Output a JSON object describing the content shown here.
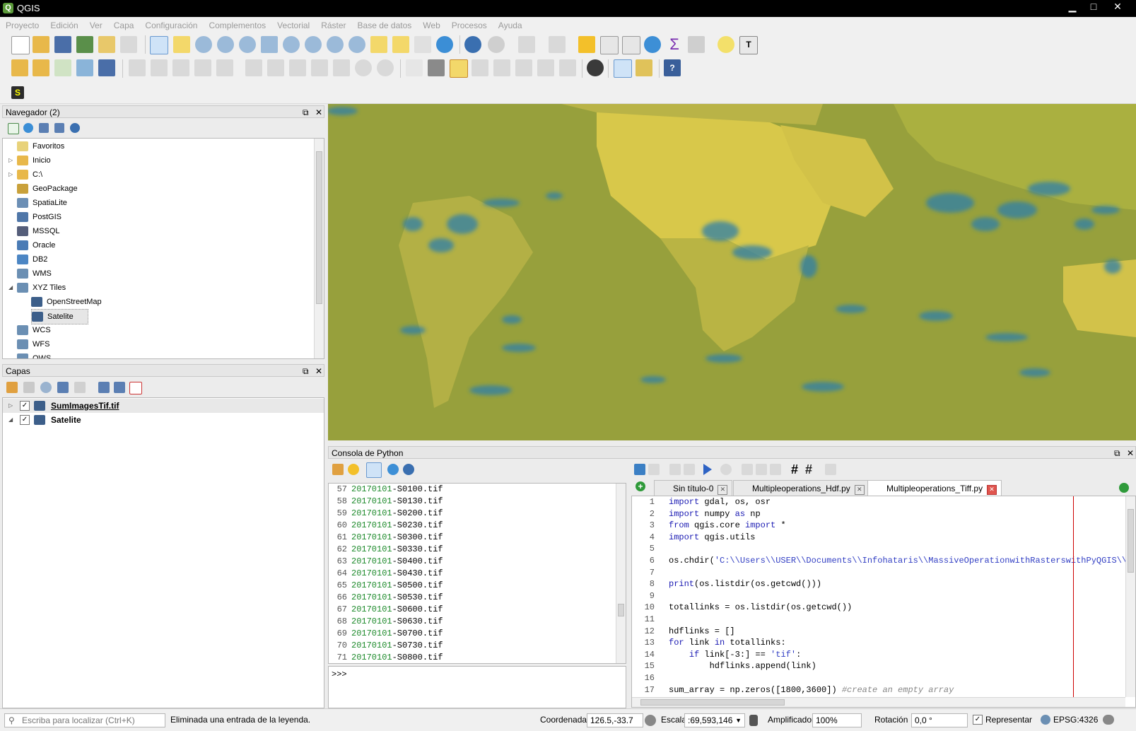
{
  "window": {
    "title": "QGIS",
    "controls": {
      "minimize": "▁",
      "maximize": "□",
      "close": "✕"
    }
  },
  "menu": [
    "Proyecto",
    "Edición",
    "Ver",
    "Capa",
    "Configuración",
    "Complementos",
    "Vectorial",
    "Ráster",
    "Base de datos",
    "Web",
    "Procesos",
    "Ayuda"
  ],
  "browser": {
    "title": "Navegador (2)",
    "items": [
      {
        "label": "Favoritos",
        "icon": "star-icon",
        "color": "#e8d27a"
      },
      {
        "label": "Inicio",
        "icon": "folder-icon",
        "color": "#e8b84a",
        "expandable": true
      },
      {
        "label": "C:\\",
        "icon": "folder-icon",
        "color": "#e8b84a",
        "expandable": true
      },
      {
        "label": "GeoPackage",
        "icon": "geopackage-icon",
        "color": "#c9a13b"
      },
      {
        "label": "SpatiaLite",
        "icon": "feather-icon",
        "color": "#6c8fb5"
      },
      {
        "label": "PostGIS",
        "icon": "elephant-icon",
        "color": "#4f76a8"
      },
      {
        "label": "MSSQL",
        "icon": "mssql-icon",
        "color": "#555e7a"
      },
      {
        "label": "Oracle",
        "icon": "oracle-icon",
        "color": "#4a7bb5"
      },
      {
        "label": "DB2",
        "icon": "db2-icon",
        "color": "#4c86c4"
      },
      {
        "label": "WMS",
        "icon": "globe-icon",
        "color": "#6b8fb3"
      },
      {
        "label": "XYZ Tiles",
        "icon": "globe-icon",
        "color": "#6b8fb3",
        "expanded": true
      },
      {
        "label": "OpenStreetMap",
        "icon": "tile-icon",
        "color": "#3d5f8a",
        "child": true
      },
      {
        "label": "Satelite",
        "icon": "tile-icon",
        "color": "#3d5f8a",
        "child": true,
        "selected": true
      },
      {
        "label": "WCS",
        "icon": "globe-icon",
        "color": "#6b8fb3"
      },
      {
        "label": "WFS",
        "icon": "globe-icon",
        "color": "#6b8fb3"
      },
      {
        "label": "OWS",
        "icon": "globe-icon",
        "color": "#6b8fb3"
      }
    ]
  },
  "layers": {
    "title": "Capas",
    "items": [
      {
        "label": "SumImagesTif.tif",
        "checked": "✓",
        "underlined": true
      },
      {
        "label": "Satelite",
        "checked": "✓"
      }
    ]
  },
  "console": {
    "title": "Consola de Python",
    "prompt": ">>>",
    "output": [
      {
        "n": "57",
        "date": "20170101",
        "rest": "-S0100.tif"
      },
      {
        "n": "58",
        "date": "20170101",
        "rest": "-S0130.tif"
      },
      {
        "n": "59",
        "date": "20170101",
        "rest": "-S0200.tif"
      },
      {
        "n": "60",
        "date": "20170101",
        "rest": "-S0230.tif"
      },
      {
        "n": "61",
        "date": "20170101",
        "rest": "-S0300.tif"
      },
      {
        "n": "62",
        "date": "20170101",
        "rest": "-S0330.tif"
      },
      {
        "n": "63",
        "date": "20170101",
        "rest": "-S0400.tif"
      },
      {
        "n": "64",
        "date": "20170101",
        "rest": "-S0430.tif"
      },
      {
        "n": "65",
        "date": "20170101",
        "rest": "-S0500.tif"
      },
      {
        "n": "66",
        "date": "20170101",
        "rest": "-S0530.tif"
      },
      {
        "n": "67",
        "date": "20170101",
        "rest": "-S0600.tif"
      },
      {
        "n": "68",
        "date": "20170101",
        "rest": "-S0630.tif"
      },
      {
        "n": "69",
        "date": "20170101",
        "rest": "-S0700.tif"
      },
      {
        "n": "70",
        "date": "20170101",
        "rest": "-S0730.tif"
      },
      {
        "n": "71",
        "date": "20170101",
        "rest": "-S0800.tif"
      }
    ],
    "tabs": [
      "Sin título-0",
      "Multipleoperations_Hdf.py",
      "Multipleoperations_Tiff.py"
    ],
    "code": [
      "import gdal, os, osr",
      "import numpy as np",
      "from qgis.core import *",
      "import qgis.utils",
      "",
      "os.chdir('C:\\\\Users\\\\USER\\\\Documents\\\\Infohataris\\\\MassiveOperationwithRasterswithPyQGIS\\\\",
      "",
      "print(os.listdir(os.getcwd()))",
      "",
      "totallinks = os.listdir(os.getcwd())",
      "",
      "hdflinks = []",
      "for link in totallinks:",
      "    if link[-3:] == 'tif':",
      "        hdflinks.append(link)",
      "",
      "sum_array = np.zeros([1800,3600]) #create an empty array"
    ]
  },
  "status": {
    "locator_placeholder": "Escriba para localizar (Ctrl+K)",
    "message": "Eliminada una entrada de la leyenda.",
    "coord_label": "Coordenada",
    "coord_value": "126.5,-33.7",
    "scale_label": "Escala",
    "scale_value": ":69,593,146",
    "magnifier_label": "Amplificador",
    "magnifier_value": "100%",
    "rotation_label": "Rotación",
    "rotation_value": "0,0 °",
    "render_label": "Representar",
    "render_checked": "✓",
    "crs": "EPSG:4326"
  },
  "colors": {
    "accent_selected": "#cfe3f7",
    "code_red_line": "#cc0000"
  }
}
